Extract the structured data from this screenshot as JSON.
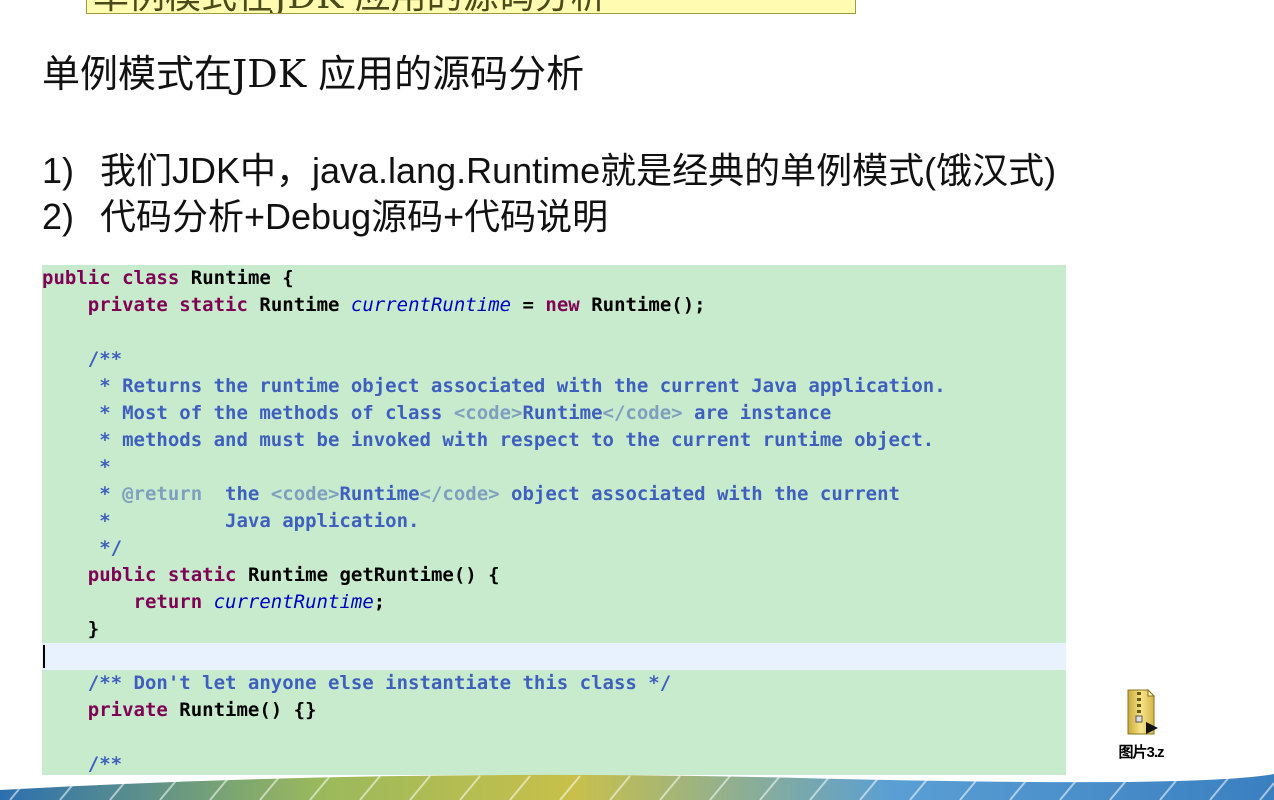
{
  "slide": {
    "top_title": "单例模式在JDK 应用的源码分析",
    "title": "单例模式在JDK 应用的源码分析",
    "bullets": [
      {
        "num": "1)",
        "text": "我们JDK中，java.lang.Runtime就是经典的单例模式(饿汉式)"
      },
      {
        "num": "2)",
        "text": "代码分析+Debug源码+代码说明"
      }
    ]
  },
  "code": {
    "tokens": {
      "public": "public",
      "class": "class",
      "private": "private",
      "static": "static",
      "new": "new",
      "return": "return",
      "runtime_type": "Runtime",
      "field": "currentRuntime",
      "open_brace": " {",
      "close_brace": "}",
      "assign_tail": "();",
      "eq": " = ",
      "getter": " getRuntime() {",
      "semicolon": ";",
      "ctor": " Runtime() {}"
    },
    "doc": {
      "open": "/**",
      "l1": " * Returns the runtime object associated with the current Java application.",
      "l2a": " * Most of the methods of class ",
      "code_open": "<code>",
      "code_close": "</code>",
      "l2b": "Runtime",
      "l2c": " are instance",
      "l3": " * methods and must be invoked with respect to the current runtime object.",
      "blank": " *",
      "l5a": " * ",
      "at_return": "@return",
      "l5b": "  the ",
      "l5c": "Runtime",
      "l5d": " object associated with the current",
      "l6": " *          Java application.",
      "close": " */"
    },
    "comment": "/** Don't let anyone else instantiate this class */",
    "last_doc_open": "/**"
  },
  "zip_file": {
    "label": "图片3.z"
  },
  "colors": {
    "code_background": "#c7ebcc",
    "current_line": "#e8f2fe",
    "keyword": "#7f0055",
    "field": "#0000c0",
    "javadoc": "#3f5fbf",
    "javadoc_tag": "#7f9fbf",
    "title_box": "#fffbb0"
  }
}
